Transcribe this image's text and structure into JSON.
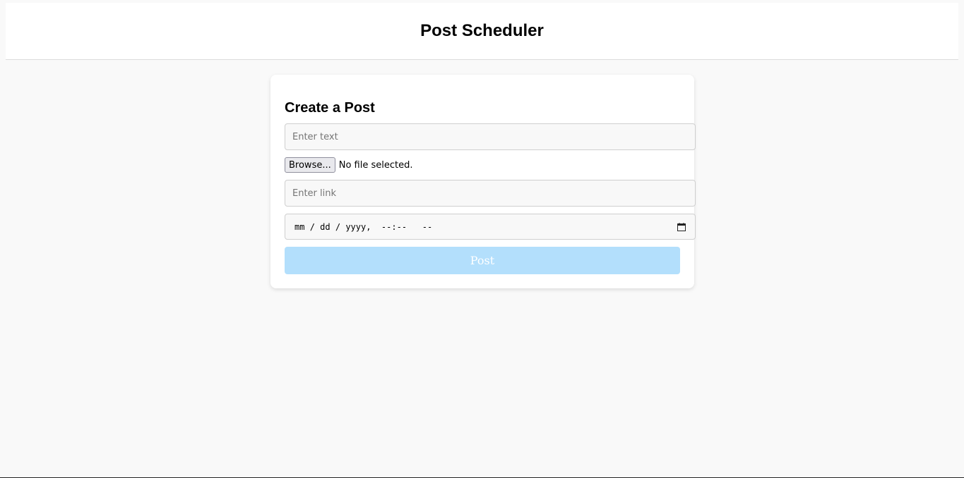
{
  "header": {
    "title": "Post Scheduler"
  },
  "form": {
    "title": "Create a Post",
    "text_placeholder": "Enter text",
    "file_button_label": "Browse...",
    "file_status": "No file selected.",
    "link_placeholder": "Enter link",
    "datetime": {
      "month": "mm",
      "sep1": "/",
      "day": "dd",
      "sep2": "/",
      "year": "yyyy",
      "comma": ",",
      "hour": "--",
      "colon": ":",
      "minute": "--",
      "ampm": "--"
    },
    "submit_label": "Post"
  },
  "colors": {
    "submit_bg": "#b3dffc",
    "page_bg": "#f9f9f9",
    "card_bg": "#ffffff"
  },
  "icons": {
    "datetime_picker": "calendar-icon"
  }
}
